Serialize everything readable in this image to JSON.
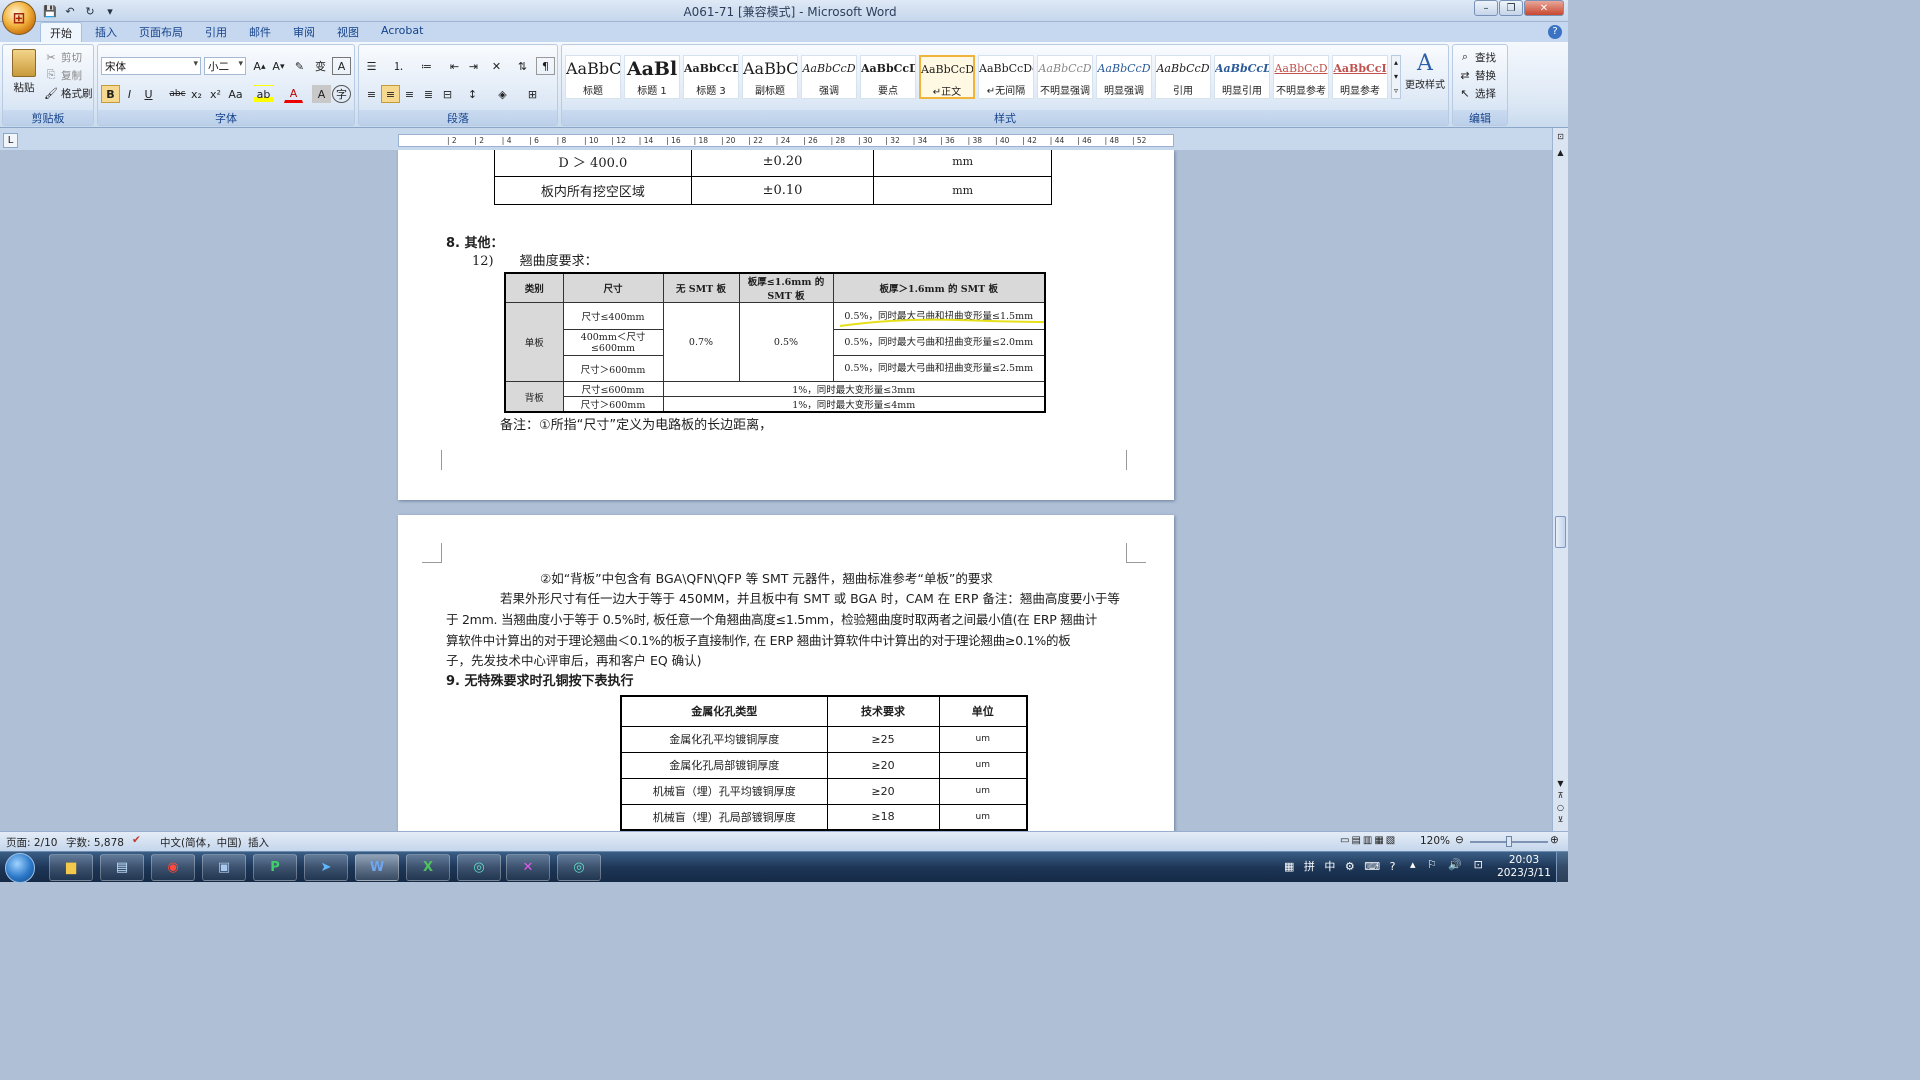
{
  "window": {
    "title": "A061-71 [兼容模式] - Microsoft Word",
    "office_button": "Office"
  },
  "tabs": [
    "开始",
    "插入",
    "页面布局",
    "引用",
    "邮件",
    "审阅",
    "视图",
    "Acrobat"
  ],
  "active_tab": "开始",
  "ribbon": {
    "clipboard": {
      "label": "剪贴板",
      "paste": "粘贴",
      "cut": "剪切",
      "copy": "复制",
      "format_painter": "格式刷"
    },
    "font": {
      "label": "字体",
      "font_name": "宋体",
      "font_size": "小二"
    },
    "paragraph": {
      "label": "段落"
    },
    "styles": {
      "label": "样式",
      "items": [
        {
          "preview": "AaBbC",
          "name": "标题"
        },
        {
          "preview": "AaBl",
          "name": "标题 1"
        },
        {
          "preview": "AaBbCcD",
          "name": "标题 3"
        },
        {
          "preview": "AaBbC",
          "name": "副标题"
        },
        {
          "preview": "AaBbCcD",
          "name": "强调"
        },
        {
          "preview": "AaBbCcD",
          "name": "要点"
        },
        {
          "preview": "AaBbCcDc",
          "name": "↵正文"
        },
        {
          "preview": "AaBbCcDc",
          "name": "↵无间隔"
        },
        {
          "preview": "AaBbCcD",
          "name": "不明显强调"
        },
        {
          "preview": "AaBbCcD",
          "name": "明显强调"
        },
        {
          "preview": "AaBbCcD",
          "name": "引用"
        },
        {
          "preview": "AaBbCcD",
          "name": "明显引用"
        },
        {
          "preview": "AaBbCcD",
          "name": "不明显参考"
        },
        {
          "preview": "AaBbCcI",
          "name": "明显参考"
        }
      ],
      "change_styles": "更改样式"
    },
    "editing": {
      "label": "编辑",
      "find": "查找",
      "replace": "替换",
      "select": "选择"
    }
  },
  "ruler_ticks": [
    "2",
    "2",
    "4",
    "6",
    "8",
    "10",
    "12",
    "14",
    "16",
    "18",
    "20",
    "22",
    "24",
    "26",
    "28",
    "30",
    "32",
    "34",
    "36",
    "38",
    "40",
    "42",
    "44",
    "46",
    "48",
    "52"
  ],
  "page1": {
    "top_table": [
      [
        "D ＞ 400.0",
        "±0.20",
        "mm"
      ],
      [
        "板内所有挖空区域",
        "±0.10",
        "mm"
      ]
    ],
    "section8": "8. 其他：",
    "item12": "12)　　翘曲度要求：",
    "warp_table": {
      "headers": [
        "类别",
        "尺寸",
        "无 SMT 板",
        "板厚≤1.6mm 的 SMT 板",
        "板厚＞1.6mm 的 SMT 板"
      ],
      "single": "单板",
      "single_sizes": [
        "尺寸≤400mm",
        "400mm＜尺寸≤600mm",
        "尺寸＞600mm"
      ],
      "no_smt": "0.7%",
      "thin_smt": "0.5%",
      "thick_smt": [
        "0.5%，同时最大弓曲和扭曲变形量≤1.5mm",
        "0.5%，同时最大弓曲和扭曲变形量≤2.0mm",
        "0.5%，同时最大弓曲和扭曲变形量≤2.5mm"
      ],
      "back": "背板",
      "back_rows": [
        [
          "尺寸≤600mm",
          "1%，同时最大变形量≤3mm"
        ],
        [
          "尺寸＞600mm",
          "1%，同时最大变形量≤4mm"
        ]
      ]
    },
    "note": "备注：①所指“尺寸”定义为电路板的长边距离，"
  },
  "page2": {
    "para1": "②如“背板”中包含有 BGA\\QFN\\QFP 等 SMT 元器件，翘曲标准参考“单板”的要求",
    "para2_l1": "若果外形尺寸有任一边大于等于 450MM，并且板中有 SMT 或 BGA 时，CAM 在 ERP 备注：翘曲高度要小于等",
    "para2_l2": "于 2mm. 当翘曲度小于等于 0.5%时, 板任意一个角翘曲高度≤1.5mm，检验翘曲度时取两者之间最小值(在 ERP 翘曲计",
    "para2_l3": "算软件中计算出的对于理论翘曲＜0.1%的板子直接制作, 在 ERP 翘曲计算软件中计算出的对于理论翘曲≥0.1%的板",
    "para2_l4": "子，先发技术中心评审后，再和客户 EQ 确认)",
    "section9": "9. 无特殊要求时孔铜按下表执行",
    "hole_table": {
      "headers": [
        "金属化孔类型",
        "技术要求",
        "单位"
      ],
      "rows": [
        [
          "金属化孔平均镀铜厚度",
          "≥25",
          "um"
        ],
        [
          "金属化孔局部镀铜厚度",
          "≥20",
          "um"
        ],
        [
          "机械盲（埋）孔平均镀铜厚度",
          "≥20",
          "um"
        ],
        [
          "机械盲（埋）孔局部镀铜厚度",
          "≥18",
          "um"
        ]
      ]
    }
  },
  "status": {
    "page": "页面: 2/10",
    "words": "字数: 5,878",
    "lang": "中文(简体，中国)",
    "mode": "插入",
    "zoom": "120%"
  },
  "tray": {
    "ime": "中",
    "time": "20:03",
    "date": "2023/3/11"
  },
  "taskbar_apps": [
    "start",
    "folder",
    "notes",
    "pdf",
    "save",
    "publisher",
    "arrow",
    "word",
    "excel",
    "eye",
    "cross",
    "eye2"
  ]
}
